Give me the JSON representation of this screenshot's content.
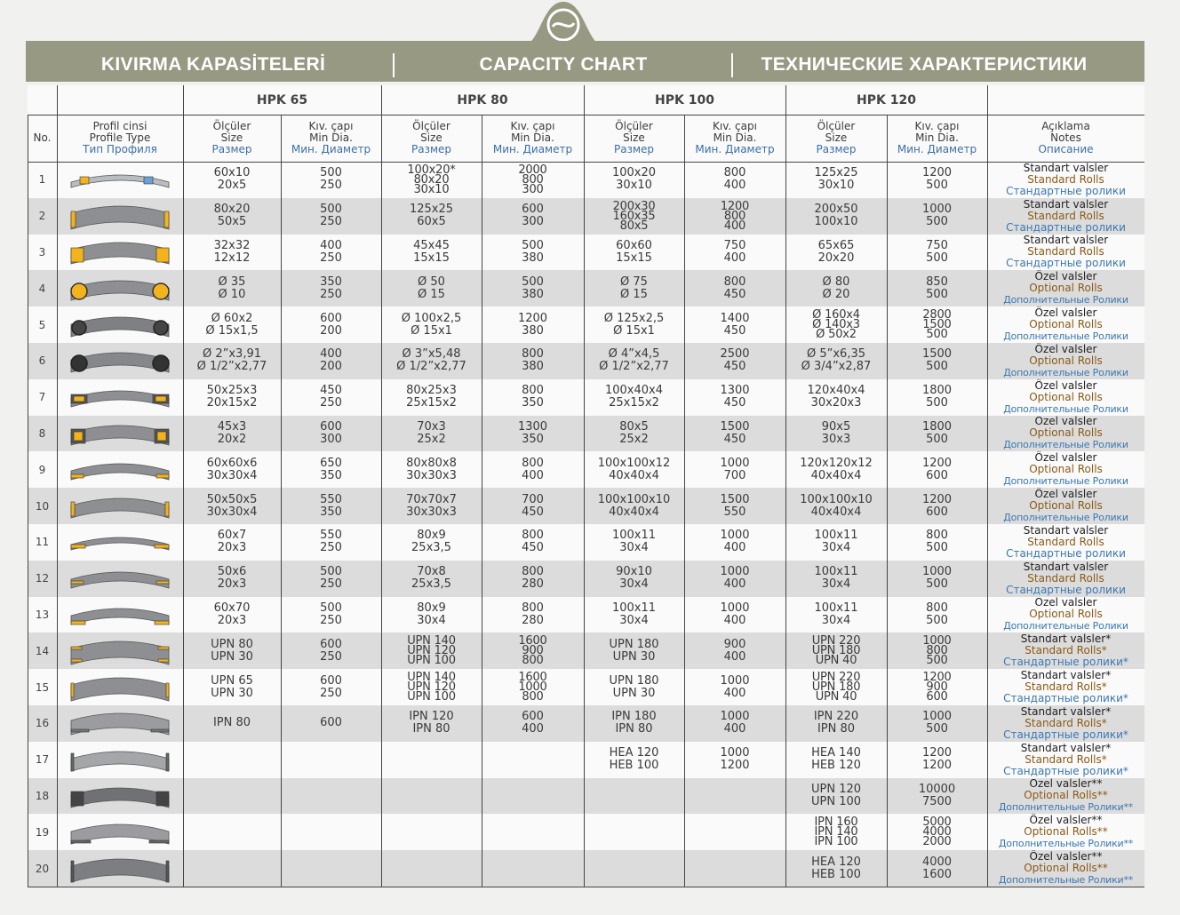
{
  "banner": {
    "title_tr": "KIVIRMA KAPASİTELERİ",
    "title_en": "CAPACITY CHART",
    "title_ru": "ТЕХНИЧЕСКИЕ ХАРАКТЕРИСТИКИ"
  },
  "groups": [
    "HPK 65",
    "HPK 80",
    "HPK 100",
    "HPK 120"
  ],
  "headers": {
    "no": "No.",
    "profile": [
      "Profil cinsi",
      "Profile Type",
      "Тип Профиля"
    ],
    "size": [
      "Ölçüler",
      "Size",
      "Размер"
    ],
    "mindia": [
      "Kıv. çapı",
      "Min Dia.",
      "Мин. Диаметр"
    ],
    "notes": [
      "Açıklama",
      "Notes",
      "Описание"
    ]
  },
  "colors": {
    "banner": "#979983",
    "row_shade": "#dcdcdc",
    "yellow_insert": "#f2b31d",
    "blue_text": "#3a6fa8",
    "brown_text": "#8a5a16"
  },
  "rows": [
    {
      "no": "1",
      "profile": "flat-bar-assorted",
      "cells": [
        [
          "60x10",
          "20x5"
        ],
        [
          "500",
          "250"
        ],
        [
          "100x20*",
          "80x20",
          "30x10"
        ],
        [
          "2000",
          "800",
          "300"
        ],
        [
          "100x20",
          "30x10"
        ],
        [
          "800",
          "400"
        ],
        [
          "125x25",
          "30x10"
        ],
        [
          "1200",
          "500"
        ]
      ],
      "notes": [
        "Standart valsler",
        "Standard Rolls",
        "Стандартные ролики"
      ]
    },
    {
      "no": "2",
      "profile": "flat-bar",
      "cells": [
        [
          "80x20",
          "50x5"
        ],
        [
          "500",
          "250"
        ],
        [
          "125x25",
          "60x5"
        ],
        [
          "600",
          "300"
        ],
        [
          "200x30",
          "160x35",
          "80x5"
        ],
        [
          "1200",
          "800",
          "400"
        ],
        [
          "200x50",
          "100x10"
        ],
        [
          "1000",
          "500"
        ]
      ],
      "notes": [
        "Standart valsler",
        "Standard Rolls",
        "Стандартные ролики"
      ]
    },
    {
      "no": "3",
      "profile": "square-bar",
      "cells": [
        [
          "32x32",
          "12x12"
        ],
        [
          "400",
          "250"
        ],
        [
          "45x45",
          "15x15"
        ],
        [
          "500",
          "380"
        ],
        [
          "60x60",
          "15x15"
        ],
        [
          "750",
          "400"
        ],
        [
          "65x65",
          "20x20"
        ],
        [
          "750",
          "500"
        ]
      ],
      "notes": [
        "Standart valsler",
        "Standard Rolls",
        "Стандартные ролики"
      ]
    },
    {
      "no": "4",
      "profile": "round-bar",
      "cells": [
        [
          "Ø 35",
          "Ø 10"
        ],
        [
          "350",
          "250"
        ],
        [
          "Ø 50",
          "Ø 15"
        ],
        [
          "500",
          "380"
        ],
        [
          "Ø 75",
          "Ø 15"
        ],
        [
          "800",
          "450"
        ],
        [
          "Ø 80",
          "Ø 20"
        ],
        [
          "850",
          "500"
        ]
      ],
      "notes": [
        "Özel valsler",
        "Optional Rolls",
        "Дополнительные Ролики"
      ]
    },
    {
      "no": "5",
      "profile": "round-tube",
      "cells": [
        [
          "Ø 60x2",
          "Ø 15x1,5"
        ],
        [
          "600",
          "200"
        ],
        [
          "Ø 100x2,5",
          "Ø 15x1"
        ],
        [
          "1200",
          "380"
        ],
        [
          "Ø 125x2,5",
          "Ø 15x1"
        ],
        [
          "1400",
          "450"
        ],
        [
          "Ø 160x4",
          "Ø 140x3",
          "Ø 50x2"
        ],
        [
          "2800",
          "1500",
          "500"
        ]
      ],
      "notes": [
        "Özel valsler",
        "Optional Rolls",
        "Дополнительные Ролики"
      ]
    },
    {
      "no": "6",
      "profile": "pipe",
      "cells": [
        [
          "Ø 2”x3,91",
          "Ø 1/2”x2,77"
        ],
        [
          "400",
          "200"
        ],
        [
          "Ø 3”x5,48",
          "Ø 1/2”x2,77"
        ],
        [
          "800",
          "380"
        ],
        [
          "Ø 4”x4,5",
          "Ø 1/2”x2,77"
        ],
        [
          "2500",
          "450"
        ],
        [
          "Ø 5”x6,35",
          "Ø 3/4”x2,87"
        ],
        [
          "1500",
          "500"
        ]
      ],
      "notes": [
        "Özel valsler",
        "Optional Rolls",
        "Дополнительные Ролики"
      ]
    },
    {
      "no": "7",
      "profile": "rect-tube",
      "cells": [
        [
          "50x25x3",
          "20x15x2"
        ],
        [
          "450",
          "250"
        ],
        [
          "80x25x3",
          "25x15x2"
        ],
        [
          "800",
          "350"
        ],
        [
          "100x40x4",
          "25x15x2"
        ],
        [
          "1300",
          "450"
        ],
        [
          "120x40x4",
          "30x20x3"
        ],
        [
          "1800",
          "500"
        ]
      ],
      "notes": [
        "Özel valsler",
        "Optional Rolls",
        "Дополнительные Ролики"
      ]
    },
    {
      "no": "8",
      "profile": "square-tube",
      "cells": [
        [
          "45x3",
          "20x2"
        ],
        [
          "600",
          "300"
        ],
        [
          "70x3",
          "25x2"
        ],
        [
          "1300",
          "350"
        ],
        [
          "80x5",
          "25x2"
        ],
        [
          "1500",
          "450"
        ],
        [
          "90x5",
          "30x3"
        ],
        [
          "1800",
          "500"
        ]
      ],
      "notes": [
        "Özel valsler",
        "Optional Rolls",
        "Дополнительные Ролики"
      ]
    },
    {
      "no": "9",
      "profile": "angle-out",
      "cells": [
        [
          "60x60x6",
          "30x30x4"
        ],
        [
          "650",
          "350"
        ],
        [
          "80x80x8",
          "30x30x3"
        ],
        [
          "800",
          "400"
        ],
        [
          "100x100x12",
          "40x40x4"
        ],
        [
          "1000",
          "700"
        ],
        [
          "120x120x12",
          "40x40x4"
        ],
        [
          "1200",
          "600"
        ]
      ],
      "notes": [
        "Özel valsler",
        "Optional Rolls",
        "Дополнительные Ролики"
      ]
    },
    {
      "no": "10",
      "profile": "angle-in",
      "cells": [
        [
          "50x50x5",
          "30x30x4"
        ],
        [
          "550",
          "350"
        ],
        [
          "70x70x7",
          "30x30x3"
        ],
        [
          "700",
          "450"
        ],
        [
          "100x100x10",
          "40x40x4"
        ],
        [
          "1500",
          "550"
        ],
        [
          "100x100x10",
          "40x40x4"
        ],
        [
          "1200",
          "600"
        ]
      ],
      "notes": [
        "Özel valsler",
        "Optional Rolls",
        "Дополнительные Ролики"
      ]
    },
    {
      "no": "11",
      "profile": "tee-out",
      "cells": [
        [
          "60x7",
          "20x3"
        ],
        [
          "550",
          "250"
        ],
        [
          "80x9",
          "25x3,5"
        ],
        [
          "800",
          "450"
        ],
        [
          "100x11",
          "30x4"
        ],
        [
          "1000",
          "400"
        ],
        [
          "100x11",
          "30x4"
        ],
        [
          "800",
          "500"
        ]
      ],
      "notes": [
        "Standart valsler",
        "Standard Rolls",
        "Стандартные ролики"
      ]
    },
    {
      "no": "12",
      "profile": "tee-in",
      "cells": [
        [
          "50x6",
          "20x3"
        ],
        [
          "500",
          "250"
        ],
        [
          "70x8",
          "25x3,5"
        ],
        [
          "800",
          "280"
        ],
        [
          "90x10",
          "30x4"
        ],
        [
          "1000",
          "400"
        ],
        [
          "100x11",
          "30x4"
        ],
        [
          "1000",
          "500"
        ]
      ],
      "notes": [
        "Standart valsler",
        "Standard Rolls",
        "Стандартные ролики"
      ]
    },
    {
      "no": "13",
      "profile": "tee-web",
      "cells": [
        [
          "60x70",
          "20x3"
        ],
        [
          "500",
          "250"
        ],
        [
          "80x9",
          "30x4"
        ],
        [
          "800",
          "280"
        ],
        [
          "100x11",
          "30x4"
        ],
        [
          "1000",
          "400"
        ],
        [
          "100x11",
          "30x4"
        ],
        [
          "800",
          "500"
        ]
      ],
      "notes": [
        "Özel valsler",
        "Optional Rolls",
        "Дополнительные Ролики"
      ]
    },
    {
      "no": "14",
      "profile": "channel-out",
      "cells": [
        [
          "UPN 80",
          "UPN 30"
        ],
        [
          "600",
          "250"
        ],
        [
          "UPN 140",
          "UPN 120",
          "UPN 100"
        ],
        [
          "1600",
          "900",
          "800"
        ],
        [
          "UPN 180",
          "UPN 30"
        ],
        [
          "900",
          "400"
        ],
        [
          "UPN 220",
          "UPN 180",
          "UPN 40"
        ],
        [
          "1000",
          "800",
          "500"
        ]
      ],
      "notes": [
        "Standart valsler*",
        "Standard Rolls*",
        "Стандартные ролики*"
      ]
    },
    {
      "no": "15",
      "profile": "channel-in",
      "cells": [
        [
          "UPN 65",
          "UPN 30"
        ],
        [
          "600",
          "250"
        ],
        [
          "UPN 140",
          "UPN 120",
          "UPN 100"
        ],
        [
          "1600",
          "1000",
          "800"
        ],
        [
          "UPN 180",
          "UPN 30"
        ],
        [
          "1000",
          "400"
        ],
        [
          "UPN 220",
          "UPN 180",
          "UPN 40"
        ],
        [
          "1200",
          "900",
          "600"
        ]
      ],
      "notes": [
        "Standart valsler*",
        "Standard Rolls*",
        "Стандартные ролики*"
      ]
    },
    {
      "no": "16",
      "profile": "ibeam",
      "cells": [
        [
          "IPN 80"
        ],
        [
          "600"
        ],
        [
          "IPN 120",
          "IPN 80"
        ],
        [
          "600",
          "400"
        ],
        [
          "IPN 180",
          "IPN 80"
        ],
        [
          "1000",
          "400"
        ],
        [
          "IPN 220",
          "IPN 80"
        ],
        [
          "1000",
          "500"
        ]
      ],
      "notes": [
        "Standart valsler*",
        "Standard Rolls*",
        "Стандартные ролики*"
      ]
    },
    {
      "no": "17",
      "profile": "hbeam",
      "cells": [
        [],
        [],
        [],
        [],
        [
          "HEA 120",
          "HEB 100"
        ],
        [
          "1000",
          "1200"
        ],
        [
          "HEA 140",
          "HEB 120"
        ],
        [
          "1200",
          "1200"
        ]
      ],
      "notes": [
        "Standart valsler*",
        "Standard Rolls*",
        "Стандартные ролики*"
      ]
    },
    {
      "no": "18",
      "profile": "channel-heavy",
      "cells": [
        [],
        [],
        [],
        [],
        [],
        [],
        [
          "UPN 120",
          "UPN 100"
        ],
        [
          "10000",
          "7500"
        ]
      ],
      "notes": [
        "Özel valsler**",
        "Optional Rolls**",
        "Дополнительные Ролики**"
      ]
    },
    {
      "no": "19",
      "profile": "ibeam-heavy",
      "cells": [
        [],
        [],
        [],
        [],
        [],
        [],
        [
          "IPN 160",
          "IPN 140",
          "IPN 100"
        ],
        [
          "5000",
          "4000",
          "2000"
        ]
      ],
      "notes": [
        "Özel valsler**",
        "Optional Rolls**",
        "Дополнительные Ролики**"
      ]
    },
    {
      "no": "20",
      "profile": "hbeam-heavy",
      "cells": [
        [],
        [],
        [],
        [],
        [],
        [],
        [
          "HEA 120",
          "HEB 100"
        ],
        [
          "4000",
          "1600"
        ]
      ],
      "notes": [
        "Özel valsler**",
        "Optional Rolls**",
        "Дополнительные Ролики**"
      ]
    }
  ]
}
